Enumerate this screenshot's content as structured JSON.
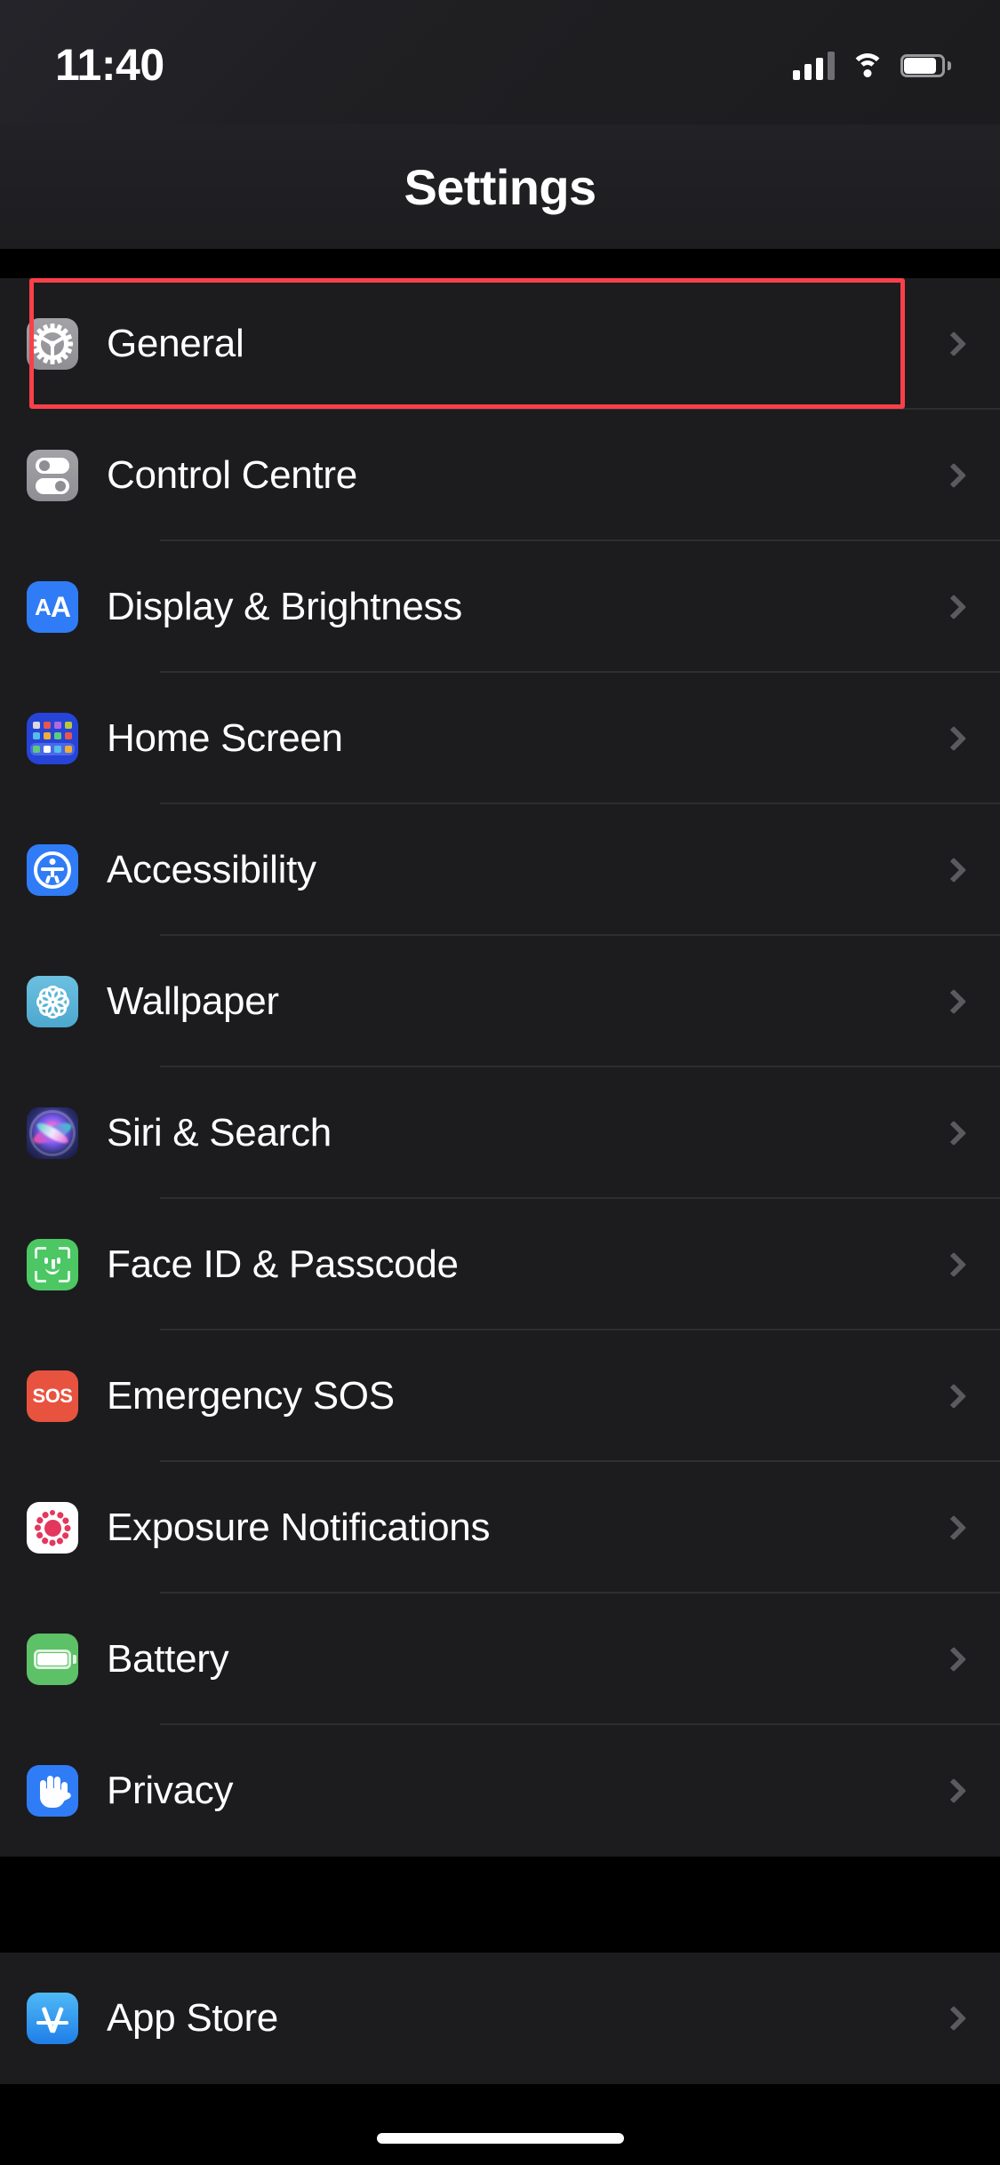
{
  "status_bar": {
    "time": "11:40",
    "signal_icon": "cellular-signal-icon",
    "signal_bars_filled": 3,
    "signal_bars_total": 4,
    "wifi_icon": "wifi-icon",
    "battery_icon": "battery-icon",
    "battery_full": true
  },
  "nav": {
    "title": "Settings"
  },
  "highlight": {
    "target": "General",
    "color": "#f9404a"
  },
  "groups": [
    {
      "id": "system-group",
      "rows": [
        {
          "label": "General",
          "icon": "gear-icon",
          "icon_color": "#8e8e93",
          "chevron": "chevron-right-icon",
          "highlighted": true
        },
        {
          "label": "Control Centre",
          "icon": "control-centre-toggles-icon",
          "icon_color": "#8e8e93",
          "chevron": "chevron-right-icon",
          "highlighted": false
        },
        {
          "label": "Display & Brightness",
          "icon": "display-aa-icon",
          "icon_color": "#2f7cf6",
          "chevron": "chevron-right-icon",
          "highlighted": false
        },
        {
          "label": "Home Screen",
          "icon": "home-screen-grid-icon",
          "icon_color": "#2644d8",
          "chevron": "chevron-right-icon",
          "highlighted": false
        },
        {
          "label": "Accessibility",
          "icon": "accessibility-person-icon",
          "icon_color": "#2f7cf6",
          "chevron": "chevron-right-icon",
          "highlighted": false
        },
        {
          "label": "Wallpaper",
          "icon": "wallpaper-flower-icon",
          "icon_color": "#4da8cf",
          "chevron": "chevron-right-icon",
          "highlighted": false
        },
        {
          "label": "Siri & Search",
          "icon": "siri-orb-icon",
          "icon_color": "#14132e",
          "chevron": "chevron-right-icon",
          "highlighted": false
        },
        {
          "label": "Face ID & Passcode",
          "icon": "face-id-icon",
          "icon_color": "#4cc764",
          "chevron": "chevron-right-icon",
          "highlighted": false
        },
        {
          "label": "Emergency SOS",
          "icon": "sos-icon",
          "icon_color": "#e8533f",
          "chevron": "chevron-right-icon",
          "highlighted": false
        },
        {
          "label": "Exposure Notifications",
          "icon": "exposure-notifications-icon",
          "icon_color": "#e4375e",
          "chevron": "chevron-right-icon",
          "highlighted": false
        },
        {
          "label": "Battery",
          "icon": "battery-icon",
          "icon_color": "#5cc167",
          "chevron": "chevron-right-icon",
          "highlighted": false
        },
        {
          "label": "Privacy",
          "icon": "privacy-hand-icon",
          "icon_color": "#2f7cf6",
          "chevron": "chevron-right-icon",
          "highlighted": false
        }
      ]
    },
    {
      "id": "store-group",
      "rows": [
        {
          "label": "App Store",
          "icon": "app-store-icon",
          "icon_color": "#1f7ee8",
          "chevron": "chevron-right-icon",
          "highlighted": false
        }
      ]
    }
  ],
  "sos_text": "SOS",
  "display_icon_text": "AA",
  "home_indicator": "home-indicator"
}
